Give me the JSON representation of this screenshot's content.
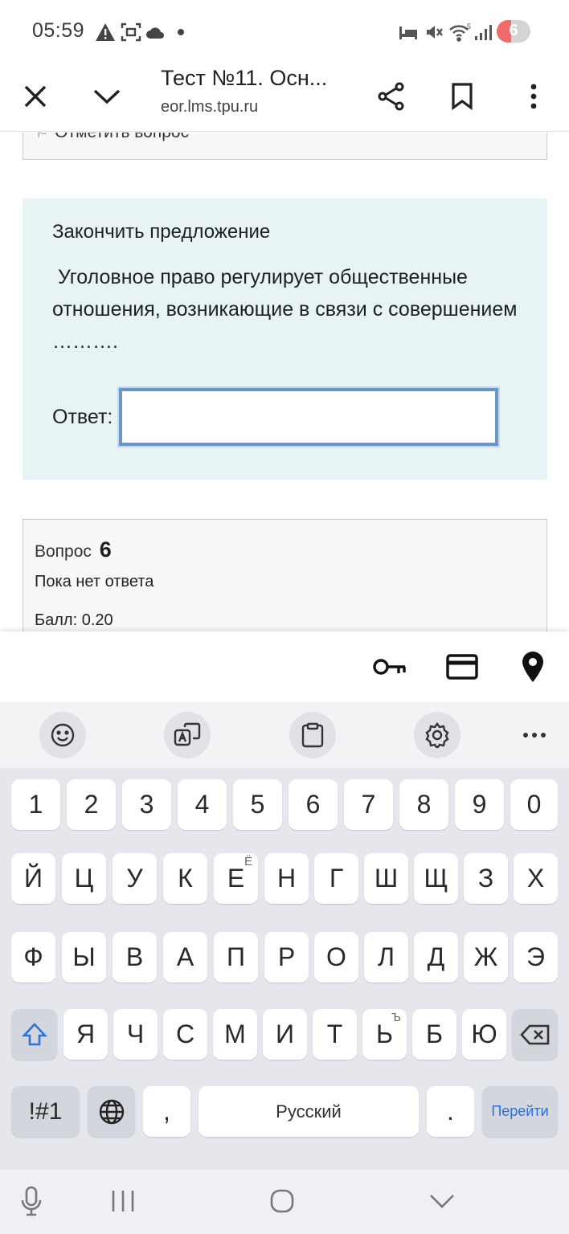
{
  "status_bar": {
    "time": "05:59",
    "battery_level": "6",
    "icons": [
      "warning-icon",
      "screenshot-icon",
      "cloud-icon",
      "dot-icon",
      "sleep-icon",
      "mute-icon",
      "wifi-5g-icon",
      "signal-icon"
    ]
  },
  "toolbar": {
    "title": "Тест №11. Осн...",
    "url": "eor.lms.tpu.ru",
    "icons": [
      "close-icon",
      "chevron-down-icon",
      "share-icon",
      "bookmark-icon",
      "more-vert-icon"
    ]
  },
  "page": {
    "flag_label": "Отметить вопрос",
    "question": {
      "header": "Закончить предложение",
      "text": " Уголовное право регулирует общественные отношения, возникающие в связи с совершением ……….",
      "answer_label": "Ответ:",
      "answer_value": ""
    },
    "next_question": {
      "label": "Вопрос",
      "number": "6",
      "status": "Пока нет ответа",
      "score": "Балл: 0.20"
    }
  },
  "autofill": {
    "icons": [
      "key-icon",
      "credit-card-icon",
      "location-pin-icon"
    ]
  },
  "keyboard": {
    "toolbar_icons": [
      "emoji-icon",
      "translate-icon",
      "clipboard-icon",
      "settings-icon",
      "more-horiz-icon"
    ],
    "row_numbers": [
      "1",
      "2",
      "3",
      "4",
      "5",
      "6",
      "7",
      "8",
      "9",
      "0"
    ],
    "row1": [
      "Й",
      "Ц",
      "У",
      "К",
      "Е",
      "Н",
      "Г",
      "Ш",
      "Щ",
      "З",
      "Х"
    ],
    "row1_alt_e": "Ё",
    "row2": [
      "Ф",
      "Ы",
      "В",
      "А",
      "П",
      "Р",
      "О",
      "Л",
      "Д",
      "Ж",
      "Э"
    ],
    "row3": [
      "Я",
      "Ч",
      "С",
      "М",
      "И",
      "Т",
      "Ь",
      "Б",
      "Ю"
    ],
    "row3_alt_soft": "Ъ",
    "symbols": "!#1",
    "comma": ",",
    "space": "Русский",
    "period": ".",
    "go": "Перейти",
    "accent_color": "#2f6fd6"
  },
  "navbar": {
    "icons": [
      "microphone-icon",
      "recent-apps-icon",
      "home-icon",
      "hide-keyboard-icon"
    ]
  }
}
